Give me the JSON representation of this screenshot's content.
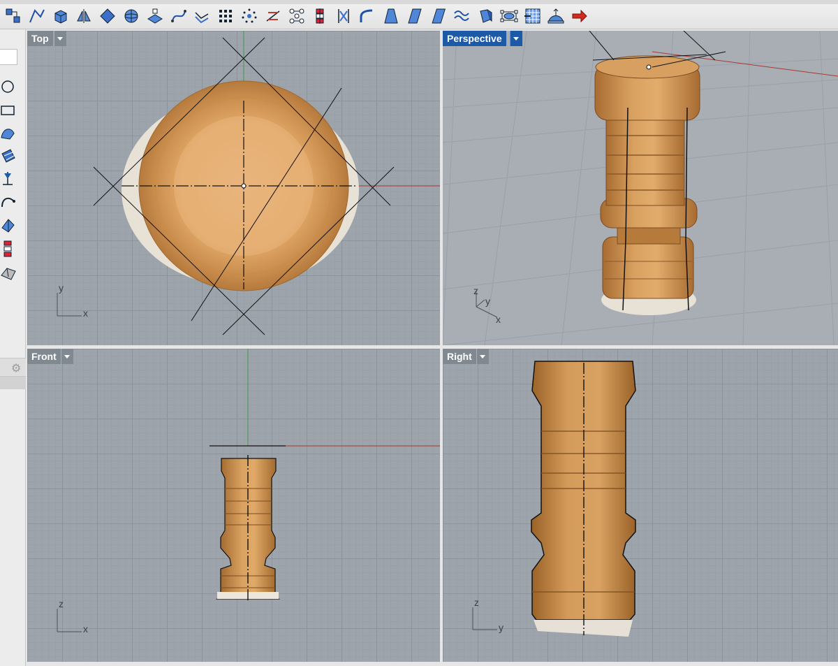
{
  "toolbar": {
    "icons": [
      "select-points-icon",
      "polyline-icon",
      "box-icon",
      "mirror-icon",
      "rotate-icon",
      "sphere-icon",
      "plane-icon",
      "curve-edit-icon",
      "offset-icon",
      "array-icon",
      "point-grid-icon",
      "bisect-icon",
      "network-icon",
      "align-icon",
      "split-icon",
      "curve-blend-icon",
      "taper-icon",
      "shear-icon",
      "skew-icon",
      "wave-icon",
      "extrude-icon",
      "bounding-box-icon",
      "mesh-grid-icon",
      "drape-icon",
      "export-arrow-icon"
    ]
  },
  "leftbar": {
    "icons": [
      "circle-icon",
      "rectangle-icon",
      "surface-icon",
      "patch-icon",
      "dimension-icon",
      "arc-icon",
      "extrude-surface-icon",
      "move-icon",
      "solid-icon"
    ]
  },
  "viewports": {
    "top": {
      "label": "Top",
      "axis_a": "y",
      "axis_b": "x"
    },
    "persp": {
      "label": "Perspective",
      "axis_a": "z",
      "axis_b": "y",
      "axis_c": "x"
    },
    "front": {
      "label": "Front",
      "axis_a": "z",
      "axis_b": "x"
    },
    "right": {
      "label": "Right",
      "axis_a": "z",
      "axis_b": "y"
    }
  },
  "colors": {
    "viewport_bg": "#9ea4ac",
    "active_label": "#1c5aa8",
    "inactive_label": "#808890",
    "x_axis": "#a63a32",
    "y_axis": "#3f9a45",
    "wood_light": "#e0a865",
    "wood_dark": "#b0743a"
  }
}
